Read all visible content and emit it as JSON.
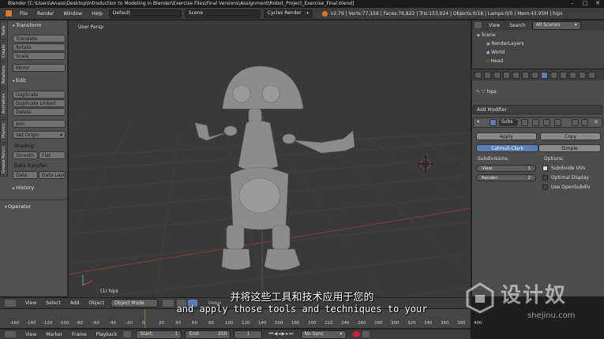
{
  "app": {
    "title": "Blender [C:\\Users\\Anass\\Desktop\\Introduction to Modeling in Blender\\Exercise Files\\Final Versions\\Assignment\\Robot_Project_Exercise_Final.blend]",
    "window_controls": [
      "–",
      "□",
      "✕"
    ]
  },
  "infobar": {
    "menus": [
      "File",
      "Render",
      "Window",
      "Help"
    ],
    "layout": "Default",
    "scene": "Scene",
    "engine": "Cycles Render",
    "stats": "v2.79 | Verts:77,156 | Faces:76,822 | Tris:153,924 | Objects:0/18 | Lamps:0/0 | Mem:43.95M | hips"
  },
  "toolshelf": {
    "transform_header": "Transform",
    "transform_buttons": [
      "Translate",
      "Rotate",
      "Scale",
      "Mirror"
    ],
    "edit_header": "Edit",
    "edit_buttons": [
      "Duplicate",
      "Duplicate Linked",
      "Delete",
      "Join"
    ],
    "set_origin": "Set Origin",
    "shading_label": "Shading:",
    "shading_buttons": [
      "Smooth",
      "Flat"
    ],
    "data_transfer_label": "Data Transfer:",
    "data_transfer_buttons": [
      "Data",
      "Data Layo"
    ],
    "history_header": "History",
    "operator_header": "Operator",
    "tabs": [
      "Tools",
      "Create",
      "Relations",
      "Animation",
      "Physics",
      "Grease Pencil"
    ]
  },
  "viewport": {
    "view_label": "User Persp",
    "object_label": "(1) hips"
  },
  "outliner": {
    "menus": [
      "View",
      "Search"
    ],
    "filter": "All Scenes",
    "items": [
      "Scene",
      "RenderLayers",
      "World",
      "Head"
    ]
  },
  "properties": {
    "object_name": "hips",
    "add_modifier": "Add Modifier",
    "modifier_name": "Subs",
    "apply": "Apply",
    "copy": "Copy",
    "algo_catmull": "Catmull-Clark",
    "algo_simple": "Simple",
    "subdivisions_label": "Subdivisions:",
    "options_label": "Options:",
    "view_label": "View:",
    "view_value": "1",
    "render_label": "Render:",
    "render_value": "2",
    "opt_subdivide_uvs": "Subdivide UVs",
    "opt_optimal_display": "Optimal Display",
    "opt_use_opensubdiv": "Use OpenSubdiv"
  },
  "viewport_header": {
    "menus": [
      "View",
      "Select",
      "Add",
      "Object"
    ],
    "mode": "Object Mode",
    "global": "Global"
  },
  "timeline": {
    "ruler": [
      "-160",
      "-140",
      "-120",
      "-100",
      "-80",
      "-60",
      "-40",
      "-20",
      "0",
      "20",
      "40",
      "60",
      "80",
      "100",
      "120",
      "140",
      "160",
      "180",
      "200",
      "220",
      "240",
      "260",
      "280",
      "300",
      "320",
      "340",
      "360",
      "380",
      "400"
    ],
    "menus": [
      "View",
      "Marker",
      "Frame",
      "Playback"
    ],
    "start": "Start:",
    "start_value": "1",
    "end": "End:",
    "end_value": "250",
    "current": "1",
    "sync": "No Sync"
  },
  "subtitles": {
    "zh": "并将这些工具和技术应用于您的",
    "en": "and apply those tools and techniques to your"
  },
  "watermark": {
    "brand": "设计奴",
    "url": "shejinu.com"
  }
}
